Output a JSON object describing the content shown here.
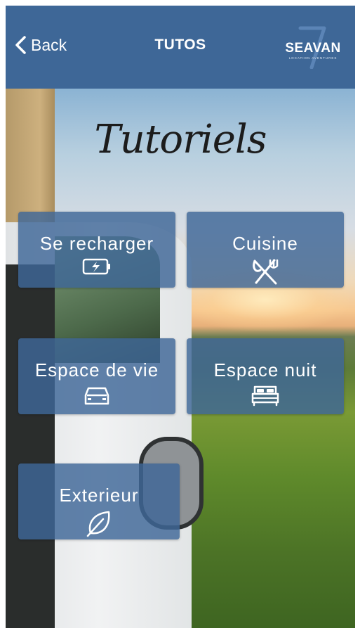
{
  "header": {
    "back_label": "Back",
    "title": "TUTOS",
    "logo_text": "SEAVAN",
    "logo_subtext": "LOCATION AVENTURES",
    "background_color": "#3e6797"
  },
  "hero": {
    "heading": "Tutoriels"
  },
  "tiles": [
    {
      "label": "Se recharger",
      "icon": "battery-charging-icon"
    },
    {
      "label": "Cuisine",
      "icon": "fork-knife-icon"
    },
    {
      "label": "Espace de vie",
      "icon": "car-icon"
    },
    {
      "label": "Espace nuit",
      "icon": "bed-icon"
    },
    {
      "label": "Exterieur",
      "icon": "leaf-icon"
    }
  ],
  "colors": {
    "tile_background": "rgba(62,103,151,0.82)",
    "text": "#ffffff"
  }
}
